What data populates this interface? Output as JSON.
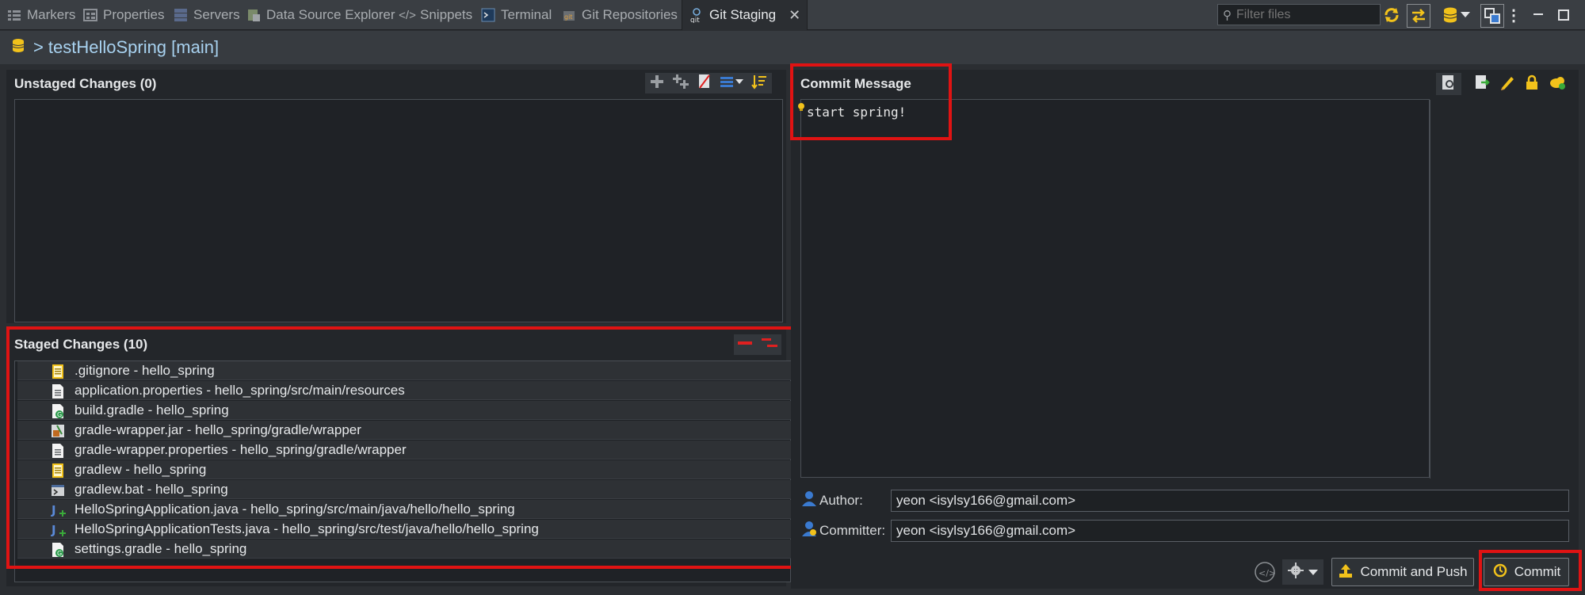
{
  "tabs": [
    {
      "label": "Markers",
      "icon": "markers-icon"
    },
    {
      "label": "Properties",
      "icon": "properties-icon"
    },
    {
      "label": "Servers",
      "icon": "servers-icon"
    },
    {
      "label": "Data Source Explorer",
      "icon": "data-source-icon"
    },
    {
      "label": "Snippets",
      "icon": "snippets-icon"
    },
    {
      "label": "Terminal",
      "icon": "terminal-icon"
    },
    {
      "label": "Git Repositories",
      "icon": "git-repositories-icon"
    },
    {
      "label": "Git Staging",
      "icon": "git-staging-icon"
    }
  ],
  "filter": {
    "placeholder": "Filter files"
  },
  "repo": {
    "prefix": ">",
    "title": "testHelloSpring [main]"
  },
  "unstaged": {
    "title": "Unstaged Changes (0)"
  },
  "staged": {
    "title": "Staged Changes (10)",
    "files": [
      {
        "label": ".gitignore - hello_spring",
        "icon": "text-file-icon"
      },
      {
        "label": "application.properties - hello_spring/src/main/resources",
        "icon": "properties-file-icon"
      },
      {
        "label": "build.gradle - hello_spring",
        "icon": "gradle-file-icon"
      },
      {
        "label": "gradle-wrapper.jar - hello_spring/gradle/wrapper",
        "icon": "jar-file-icon"
      },
      {
        "label": "gradle-wrapper.properties - hello_spring/gradle/wrapper",
        "icon": "properties-file-icon"
      },
      {
        "label": "gradlew - hello_spring",
        "icon": "text-file-icon"
      },
      {
        "label": "gradlew.bat - hello_spring",
        "icon": "bat-file-icon"
      },
      {
        "label": "HelloSpringApplication.java - hello_spring/src/main/java/hello/hello_spring",
        "icon": "java-file-added-icon"
      },
      {
        "label": "HelloSpringApplicationTests.java - hello_spring/src/test/java/hello/hello_spring",
        "icon": "java-file-added-icon"
      },
      {
        "label": "settings.gradle - hello_spring",
        "icon": "gradle-file-icon"
      }
    ]
  },
  "commit": {
    "title": "Commit Message",
    "message": "start spring!",
    "author_label": "Author:",
    "author_value": "yeon <isylsy166@gmail.com>",
    "committer_label": "Committer:",
    "committer_value": "yeon <isylsy166@gmail.com>",
    "commit_and_push_label": "Commit and Push",
    "commit_label": "Commit"
  },
  "colors": {
    "highlight": "#e01313",
    "accent_yellow": "#f2c21b",
    "background": "#1f2226"
  }
}
